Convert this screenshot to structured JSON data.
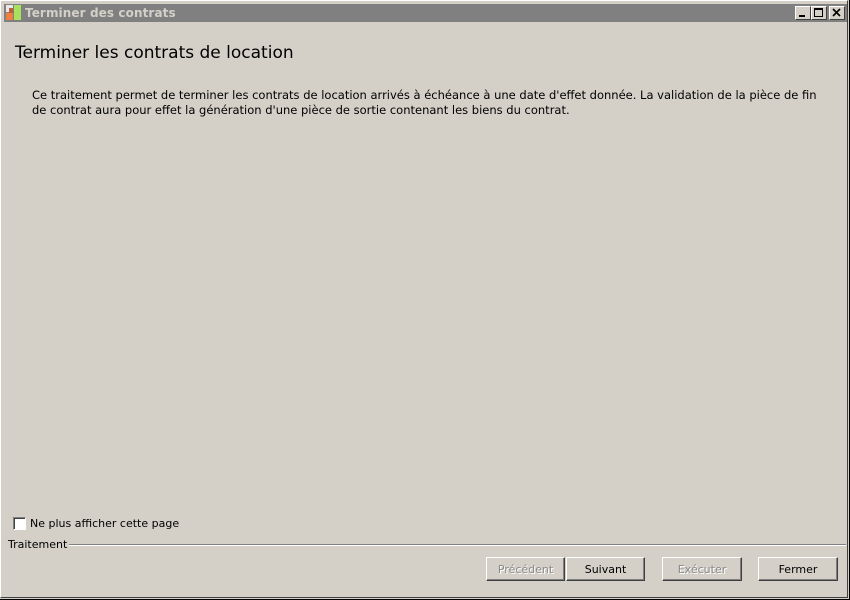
{
  "window": {
    "title": "Terminer des contrats",
    "title_bar_color": "#808080",
    "controls": {
      "minimize": "minimize-icon",
      "maximize": "maximize-icon",
      "close": "close-icon"
    }
  },
  "page": {
    "heading": "Terminer les contrats de location",
    "description": "Ce traitement permet de terminer les contrats de location arrivés à échéance à une date d'effet donnée. La validation de la pièce de fin de contrat aura pour effet la génération d'une pièce de sortie contenant les biens du contrat."
  },
  "options": {
    "hide_page_label": "Ne plus afficher cette page",
    "hide_page_checked": false
  },
  "footer": {
    "group_label": "Traitement",
    "buttons": {
      "previous": "Précédent",
      "next": "Suivant",
      "execute": "Exécuter",
      "close": "Fermer"
    }
  }
}
